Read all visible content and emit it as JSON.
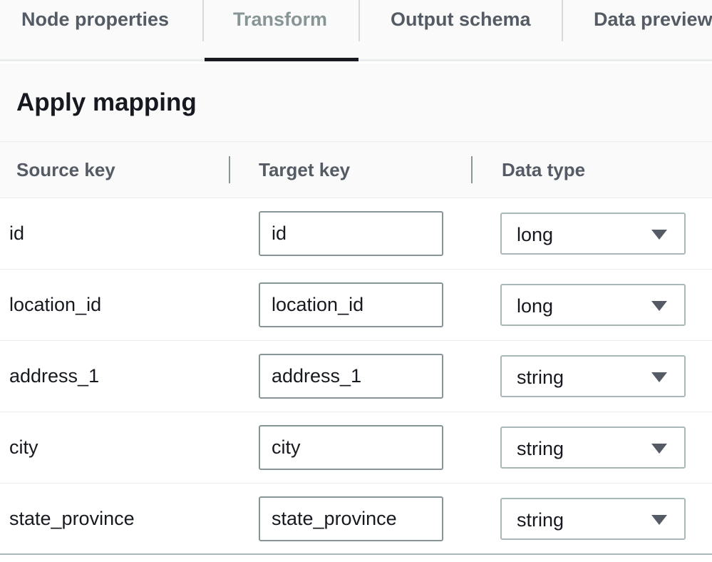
{
  "tabs": [
    {
      "label": "Node properties",
      "active": false
    },
    {
      "label": "Transform",
      "active": true
    },
    {
      "label": "Output schema",
      "active": false
    },
    {
      "label": "Data preview",
      "active": false
    }
  ],
  "section": {
    "title": "Apply mapping"
  },
  "columns": {
    "source_key": "Source key",
    "target_key": "Target key",
    "data_type": "Data type"
  },
  "mappings": [
    {
      "source": "id",
      "target": "id",
      "type": "long"
    },
    {
      "source": "location_id",
      "target": "location_id",
      "type": "long"
    },
    {
      "source": "address_1",
      "target": "address_1",
      "type": "string"
    },
    {
      "source": "city",
      "target": "city",
      "type": "string"
    },
    {
      "source": "state_province",
      "target": "state_province",
      "type": "string"
    }
  ],
  "icons": {
    "dropdown": "caret-down-icon"
  },
  "colors": {
    "active_tab_underline": "#16191f",
    "header_background": "#fafafa",
    "label_gray": "#545b64"
  }
}
